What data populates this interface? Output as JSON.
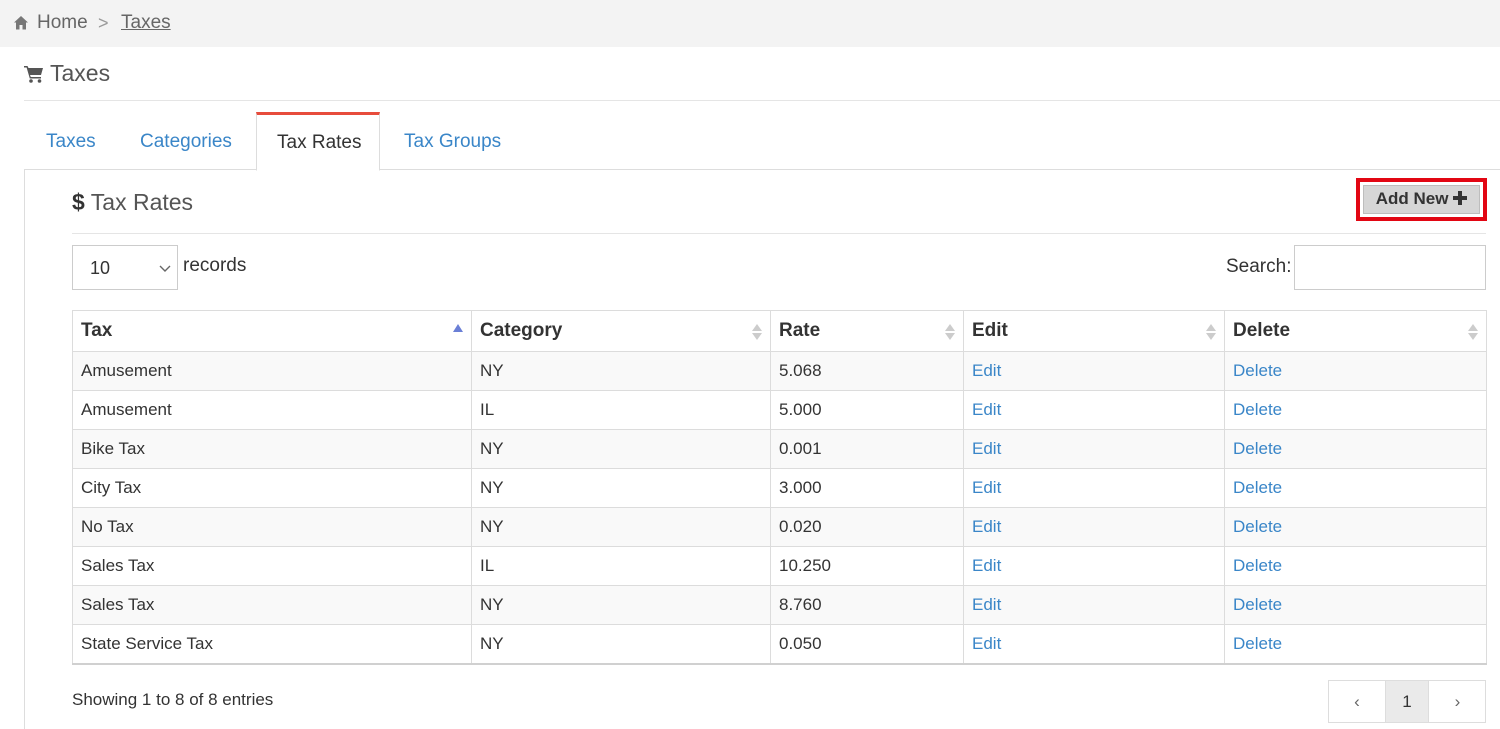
{
  "breadcrumb": {
    "home": "Home",
    "separator": ">",
    "current": "Taxes"
  },
  "page": {
    "title": "Taxes"
  },
  "tabs": [
    {
      "label": "Taxes",
      "active": false
    },
    {
      "label": "Categories",
      "active": false
    },
    {
      "label": "Tax Rates",
      "active": true
    },
    {
      "label": "Tax Groups",
      "active": false
    }
  ],
  "section": {
    "icon": "$",
    "title": "Tax Rates",
    "add_new_label": "Add New"
  },
  "controls": {
    "page_length": "10",
    "records_label": "records",
    "search_label": "Search:",
    "search_value": ""
  },
  "table": {
    "columns": [
      "Tax",
      "Category",
      "Rate",
      "Edit",
      "Delete"
    ],
    "rows": [
      {
        "tax": "Amusement",
        "category": "NY",
        "rate": "5.068",
        "edit": "Edit",
        "delete": "Delete"
      },
      {
        "tax": "Amusement",
        "category": "IL",
        "rate": "5.000",
        "edit": "Edit",
        "delete": "Delete"
      },
      {
        "tax": "Bike Tax",
        "category": "NY",
        "rate": "0.001",
        "edit": "Edit",
        "delete": "Delete"
      },
      {
        "tax": "City Tax",
        "category": "NY",
        "rate": "3.000",
        "edit": "Edit",
        "delete": "Delete"
      },
      {
        "tax": "No Tax",
        "category": "NY",
        "rate": "0.020",
        "edit": "Edit",
        "delete": "Delete"
      },
      {
        "tax": "Sales Tax",
        "category": "IL",
        "rate": "10.250",
        "edit": "Edit",
        "delete": "Delete"
      },
      {
        "tax": "Sales Tax",
        "category": "NY",
        "rate": "8.760",
        "edit": "Edit",
        "delete": "Delete"
      },
      {
        "tax": "State Service Tax",
        "category": "NY",
        "rate": "0.050",
        "edit": "Edit",
        "delete": "Delete"
      }
    ]
  },
  "footer": {
    "info": "Showing 1 to 8 of 8 entries",
    "pagination": {
      "prev": "‹",
      "current_page": "1",
      "next": "›"
    }
  },
  "colors": {
    "link": "#3a86c8",
    "active_tab_accent": "#e74c3c",
    "highlight_outline": "#e20613",
    "sort_active": "#6a7fd6"
  },
  "icons": {
    "breadcrumb": "home-icon",
    "title": "cart-icon",
    "add_new": "plus-icon",
    "length": "chevron-down-icon"
  }
}
